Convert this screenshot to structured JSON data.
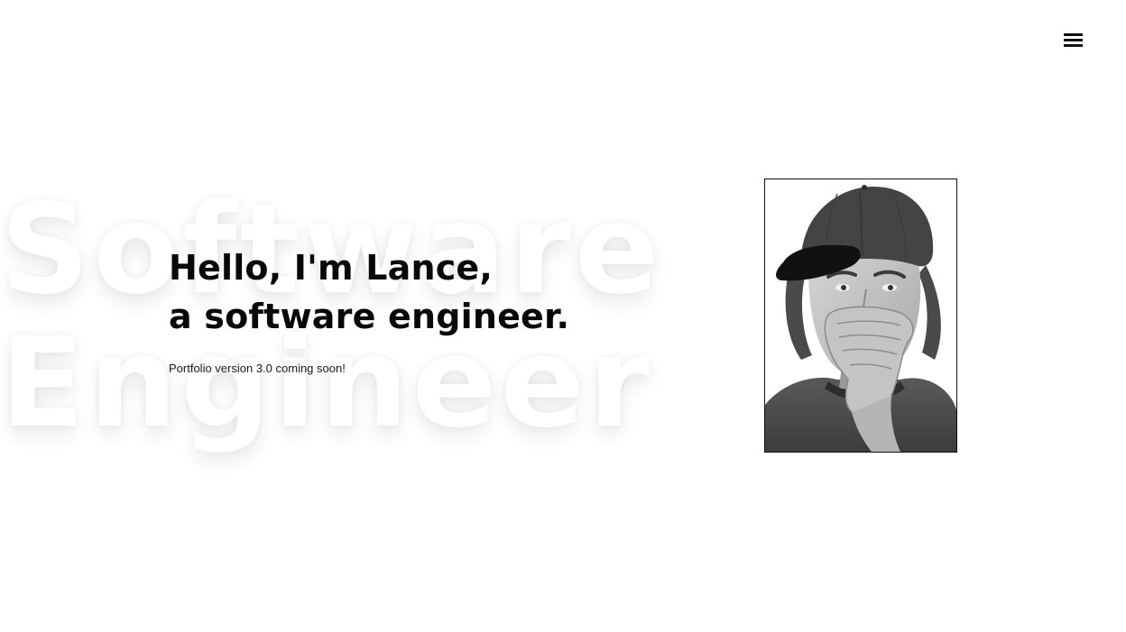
{
  "header": {
    "menu_icon": "hamburger-menu-icon"
  },
  "background": {
    "word_line1": "Software",
    "word_line2": "Engineer"
  },
  "hero": {
    "greeting_line1": "Hello, I'm Lance,",
    "greeting_line2": "a software engineer.",
    "subtitle": "Portfolio version 3.0 coming soon!"
  },
  "portrait": {
    "description_icon": "profile-photo",
    "style": "black-and-white"
  },
  "colors": {
    "background": "#ffffff",
    "text": "#0b0b0b",
    "frame_border": "#111111"
  }
}
